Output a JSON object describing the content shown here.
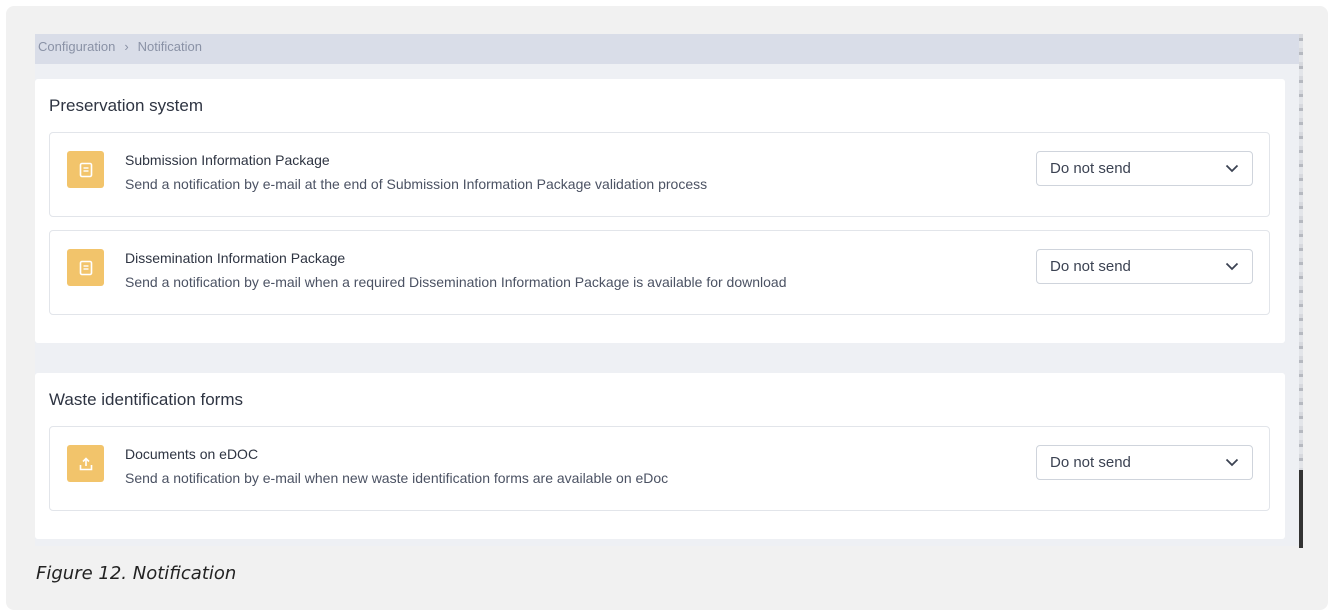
{
  "breadcrumb": {
    "items": [
      "Configuration",
      "Notification"
    ],
    "separator": "›"
  },
  "preservation": {
    "title": "Preservation system",
    "rows": [
      {
        "icon": "document-icon",
        "title": "Submission Information Package",
        "description": "Send a notification by e-mail at the end of Submission Information Package validation process",
        "select_value": "Do not send"
      },
      {
        "icon": "document-icon",
        "title": "Dissemination Information Package",
        "description": "Send a notification by e-mail when a required Dissemination Information Package is available for download",
        "select_value": "Do not send"
      }
    ]
  },
  "waste": {
    "title": "Waste identification forms",
    "rows": [
      {
        "icon": "upload-icon",
        "title": "Documents on eDOC",
        "description": "Send a notification by e-mail when new waste identification forms are available on eDoc",
        "select_value": "Do not send"
      }
    ]
  },
  "caption": "Figure 12. Notification",
  "colors": {
    "icon_bg": "#f2c46b",
    "breadcrumb_bg": "#d9dde8",
    "page_bg": "#eef0f4"
  }
}
